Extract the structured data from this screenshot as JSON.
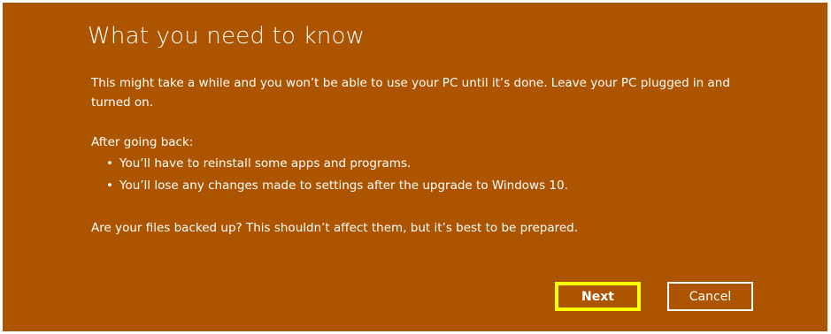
{
  "dialog": {
    "title": "What you need to know",
    "intro": "This might take a while and you won’t be able to use your PC until it’s done. Leave your PC plugged in and turned on.",
    "after_heading": "After going back:",
    "bullet_glyph": "•",
    "bullets": [
      "You’ll have to reinstall some apps and programs.",
      "You’ll lose any changes made to settings after the upgrade to Windows 10."
    ],
    "question": "Are your files backed up? This shouldn’t affect them, but it’s best to be prepared.",
    "buttons": {
      "next_label": "Next",
      "cancel_label": "Cancel"
    }
  },
  "colors": {
    "background": "#ad5400",
    "text": "#ffffff",
    "focus_highlight": "#ffff00"
  }
}
